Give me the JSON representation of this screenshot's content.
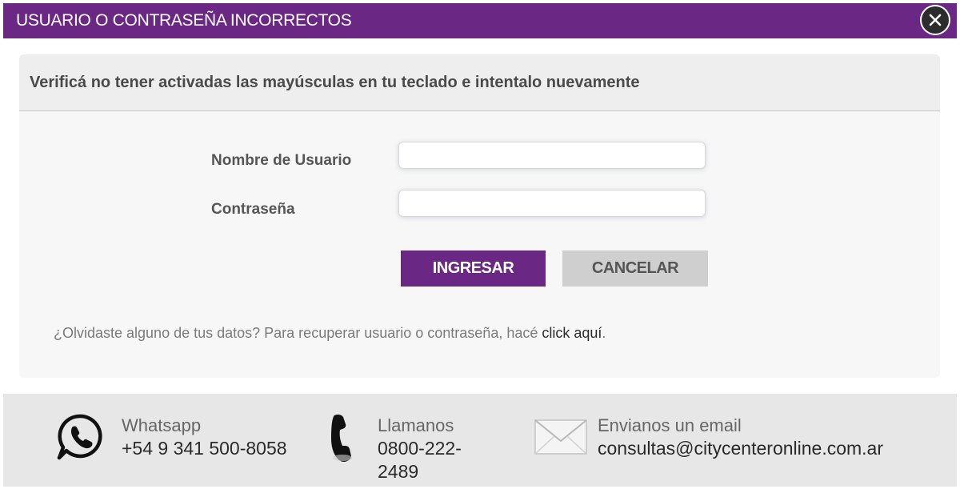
{
  "modal": {
    "title": "USUARIO O CONTRASEÑA INCORRECTOS",
    "close_icon": "close-icon",
    "accent_color": "#6a2784"
  },
  "notice": "Verificá no tener activadas las mayúsculas en tu teclado e intentalo nuevamente",
  "form": {
    "username_label": "Nombre de Usuario",
    "username_value": "",
    "password_label": "Contraseña",
    "password_value": "",
    "submit_label": "INGRESAR",
    "cancel_label": "CANCELAR"
  },
  "recover": {
    "text": "¿Olvidaste alguno de tus datos? Para recuperar usuario o contraseña, hacé ",
    "link_label": "click aquí",
    "suffix": "."
  },
  "contact": {
    "whatsapp": {
      "icon": "whatsapp-icon",
      "title": "Whatsapp",
      "value": "+54 9 341 500-8058"
    },
    "phone": {
      "icon": "phone-icon",
      "title": "Llamanos",
      "value_line1": "0800-222-",
      "value_line2": "2489"
    },
    "email": {
      "icon": "envelope-icon",
      "title": "Envianos un email",
      "value": "consultas@citycenteronline.com.ar"
    }
  }
}
